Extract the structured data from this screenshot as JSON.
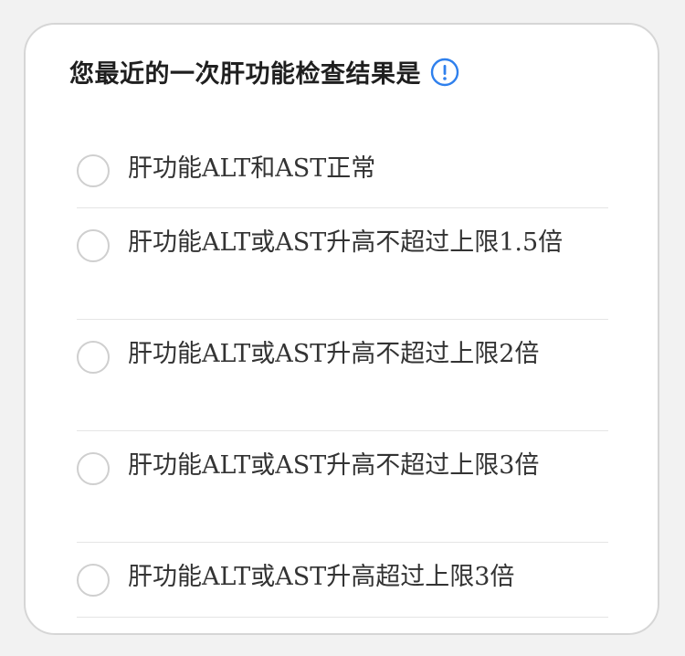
{
  "question": {
    "text": "您最近的一次肝功能检查结果是",
    "info_icon": "info-circle-icon",
    "accent_color": "#2f80ed"
  },
  "options": [
    {
      "label": "肝功能ALT和AST正常",
      "selected": false
    },
    {
      "label": "肝功能ALT或AST升高不超过上限1.5倍",
      "selected": false
    },
    {
      "label": "肝功能ALT或AST升高不超过上限2倍",
      "selected": false
    },
    {
      "label": "肝功能ALT或AST升高不超过上限3倍",
      "selected": false
    },
    {
      "label": "肝功能ALT或AST升高超过上限3倍",
      "selected": false
    }
  ]
}
